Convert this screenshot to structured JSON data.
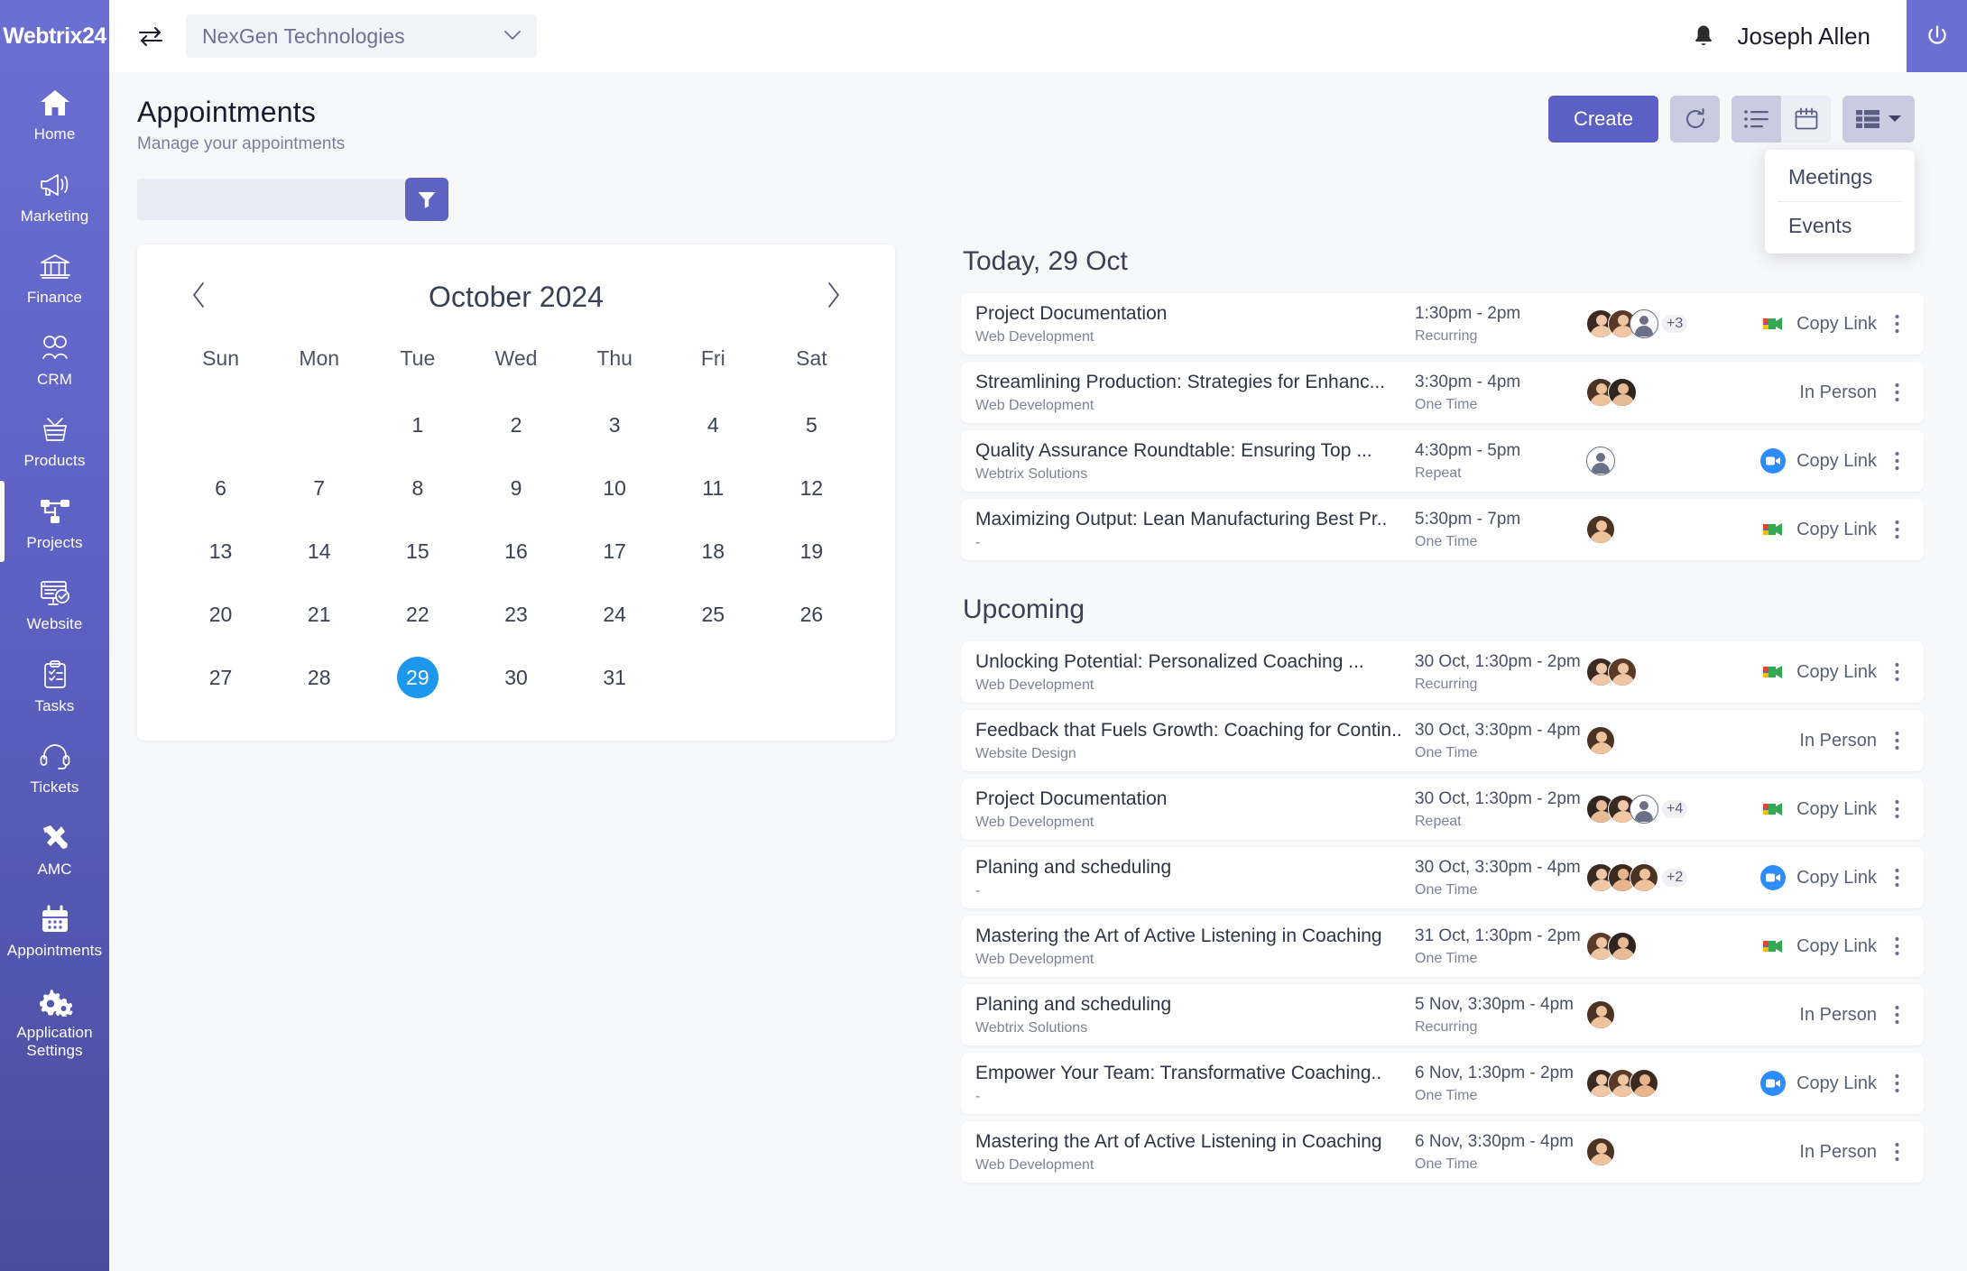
{
  "brand": {
    "name": "Webtrix24"
  },
  "topbar": {
    "switch_icon": "switch-arrows-icon",
    "org_selected": "NexGen Technologies",
    "chevron": "⌄",
    "bell_icon": "bell-icon",
    "user_name": "Joseph Allen",
    "power_icon": "power-icon"
  },
  "sidebar": {
    "items": [
      {
        "label": "Home",
        "icon": "home-icon",
        "active": false
      },
      {
        "label": "Marketing",
        "icon": "megaphone-icon",
        "active": false
      },
      {
        "label": "Finance",
        "icon": "bank-icon",
        "active": false
      },
      {
        "label": "CRM",
        "icon": "people-icon",
        "active": false
      },
      {
        "label": "Products",
        "icon": "basket-icon",
        "active": false
      },
      {
        "label": "Projects",
        "icon": "sitemap-icon",
        "active": true
      },
      {
        "label": "Website",
        "icon": "monitor-check-icon",
        "active": false
      },
      {
        "label": "Tasks",
        "icon": "clipboard-icon",
        "active": false
      },
      {
        "label": "Tickets",
        "icon": "headset-icon",
        "active": false
      },
      {
        "label": "AMC",
        "icon": "tools-icon",
        "active": false
      },
      {
        "label": "Appointments",
        "icon": "calendar-icon",
        "active": false
      },
      {
        "label": "Application Settings",
        "icon": "gears-icon",
        "active": false
      }
    ]
  },
  "page": {
    "title": "Appointments",
    "subtitle": "Manage your appointments"
  },
  "toolbar": {
    "create_label": "Create",
    "refresh_icon": "refresh-icon",
    "list_view_icon": "list-view-icon",
    "calendar_view_icon": "calendar-view-icon",
    "table_view_icon": "table-view-icon",
    "dropdown_caret_icon": "caret-down-icon",
    "dropdown_items": [
      "Meetings",
      "Events"
    ]
  },
  "filter": {
    "input_value": "",
    "input_placeholder": "",
    "button_icon": "funnel-icon"
  },
  "calendar": {
    "prev_icon": "chevron-left-icon",
    "next_icon": "chevron-right-icon",
    "month_label": "October 2024",
    "day_names": [
      "Sun",
      "Mon",
      "Tue",
      "Wed",
      "Thu",
      "Fri",
      "Sat"
    ],
    "lead_blanks": 2,
    "days": [
      1,
      2,
      3,
      4,
      5,
      6,
      7,
      8,
      9,
      10,
      11,
      12,
      13,
      14,
      15,
      16,
      17,
      18,
      19,
      20,
      21,
      22,
      23,
      24,
      25,
      26,
      27,
      28,
      29,
      30,
      31
    ],
    "selected_day": 29,
    "selected_color": "#1c97ec"
  },
  "sections": [
    {
      "heading": "Today, 29 Oct",
      "appointments": [
        {
          "title": "Project Documentation",
          "subtitle": "Web Development",
          "time": "1:30pm - 2pm",
          "recurrence": "Recurring",
          "avatars": [
            "photo-female",
            "photo-female",
            "placeholder"
          ],
          "avatar_overflow": "+3",
          "action_type": "google-meet",
          "action_label": "Copy Link",
          "kebab_icon": "kebab-menu-icon"
        },
        {
          "title": "Streamlining Production: Strategies for Enhanc...",
          "subtitle": "Web Development",
          "time": "3:30pm - 4pm",
          "recurrence": "One Time",
          "avatars": [
            "photo-male",
            "photo-female"
          ],
          "avatar_overflow": "",
          "action_type": "in-person",
          "action_label": "In Person",
          "kebab_icon": "kebab-menu-icon"
        },
        {
          "title": "Quality Assurance Roundtable: Ensuring Top ...",
          "subtitle": "Webtrix Solutions",
          "time": "4:30pm - 5pm",
          "recurrence": "Repeat",
          "avatars": [
            "placeholder"
          ],
          "avatar_overflow": "",
          "action_type": "zoom",
          "action_label": "Copy Link",
          "kebab_icon": "kebab-menu-icon"
        },
        {
          "title": "Maximizing Output: Lean Manufacturing Best Pr..",
          "subtitle": "-",
          "time": "5:30pm - 7pm",
          "recurrence": "One Time",
          "avatars": [
            "photo-male"
          ],
          "avatar_overflow": "",
          "action_type": "google-meet",
          "action_label": "Copy Link",
          "kebab_icon": "kebab-menu-icon"
        }
      ]
    },
    {
      "heading": "Upcoming",
      "appointments": [
        {
          "title": "Unlocking Potential: Personalized Coaching ...",
          "subtitle": "Web Development",
          "time": "30 Oct, 1:30pm - 2pm",
          "recurrence": "Recurring",
          "avatars": [
            "photo-female",
            "photo-female"
          ],
          "avatar_overflow": "",
          "action_type": "google-meet",
          "action_label": "Copy Link",
          "kebab_icon": "kebab-menu-icon"
        },
        {
          "title": "Feedback that Fuels Growth: Coaching for Contin..",
          "subtitle": "Website Design",
          "time": "30 Oct, 3:30pm - 4pm",
          "recurrence": "One Time",
          "avatars": [
            "photo-male"
          ],
          "avatar_overflow": "",
          "action_type": "in-person",
          "action_label": "In Person",
          "kebab_icon": "kebab-menu-icon"
        },
        {
          "title": "Project Documentation",
          "subtitle": "Web Development",
          "time": "30 Oct, 1:30pm - 2pm",
          "recurrence": "Repeat",
          "avatars": [
            "photo-female",
            "photo-female",
            "placeholder"
          ],
          "avatar_overflow": "+4",
          "action_type": "google-meet",
          "action_label": "Copy Link",
          "kebab_icon": "kebab-menu-icon"
        },
        {
          "title": "Planing and scheduling",
          "subtitle": "-",
          "time": "30 Oct, 3:30pm - 4pm",
          "recurrence": "One Time",
          "avatars": [
            "photo-female",
            "photo-male",
            "photo-male"
          ],
          "avatar_overflow": "+2",
          "action_type": "zoom",
          "action_label": "Copy Link",
          "kebab_icon": "kebab-menu-icon"
        },
        {
          "title": "Mastering the Art of Active Listening in Coaching",
          "subtitle": "Web Development",
          "time": "31 Oct, 1:30pm - 2pm",
          "recurrence": "One Time",
          "avatars": [
            "photo-female",
            "photo-female"
          ],
          "avatar_overflow": "",
          "action_type": "google-meet",
          "action_label": "Copy Link",
          "kebab_icon": "kebab-menu-icon"
        },
        {
          "title": "Planing and scheduling",
          "subtitle": "Webtrix Solutions",
          "time": "5 Nov,  3:30pm - 4pm",
          "recurrence": "Recurring",
          "avatars": [
            "photo-male"
          ],
          "avatar_overflow": "",
          "action_type": "in-person",
          "action_label": "In Person",
          "kebab_icon": "kebab-menu-icon"
        },
        {
          "title": "Empower Your Team: Transformative Coaching..",
          "subtitle": "-",
          "time": "6 Nov,  1:30pm - 2pm",
          "recurrence": "One Time",
          "avatars": [
            "photo-female",
            "photo-female",
            "photo-male"
          ],
          "avatar_overflow": "",
          "action_type": "zoom",
          "action_label": "Copy Link",
          "kebab_icon": "kebab-menu-icon"
        },
        {
          "title": "Mastering the Art of Active Listening in Coaching",
          "subtitle": "Web Development",
          "time": "6 Nov,  3:30pm - 4pm",
          "recurrence": "One Time",
          "avatars": [
            "photo-male"
          ],
          "avatar_overflow": "",
          "action_type": "in-person",
          "action_label": "In Person",
          "kebab_icon": "kebab-menu-icon"
        }
      ]
    }
  ],
  "colors": {
    "brand_purple": "#6c6fd2",
    "accent_blue": "#1c97ec",
    "zoom_blue": "#2d8cff",
    "page_bg": "#f7f8fa"
  }
}
